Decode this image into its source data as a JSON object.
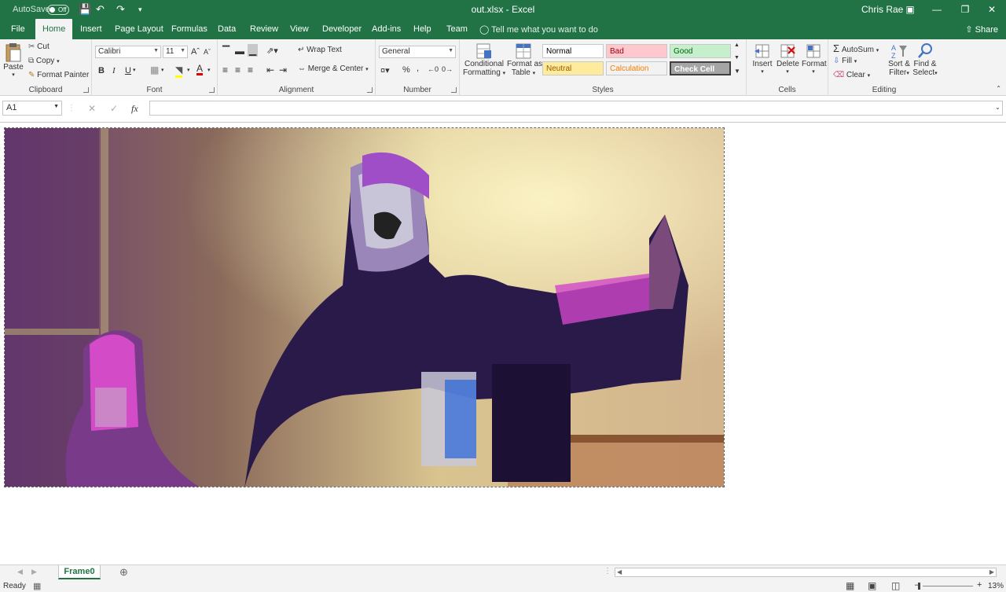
{
  "titlebar": {
    "autosave_label": "AutoSave",
    "autosave_state": "Off",
    "document_title": "out.xlsx  -  Excel",
    "user_name": "Chris Rae"
  },
  "tabs": [
    "File",
    "Home",
    "Insert",
    "Page Layout",
    "Formulas",
    "Data",
    "Review",
    "View",
    "Developer",
    "Add-ins",
    "Help",
    "Team"
  ],
  "active_tab": "Home",
  "tell_me_placeholder": "Tell me what you want to do",
  "share_label": "Share",
  "clipboard": {
    "paste": "Paste",
    "cut": "Cut",
    "copy": "Copy",
    "format_painter": "Format Painter",
    "group_label": "Clipboard"
  },
  "font": {
    "name": "Calibri",
    "size": "11",
    "bold": "B",
    "italic": "I",
    "underline": "U",
    "group_label": "Font"
  },
  "alignment": {
    "wrap_text": "Wrap Text",
    "merge_center": "Merge & Center",
    "group_label": "Alignment"
  },
  "number": {
    "format": "General",
    "percent": "%",
    "comma": ",",
    "group_label": "Number"
  },
  "styles": {
    "conditional_formatting": [
      "Conditional",
      "Formatting"
    ],
    "format_as_table": [
      "Format as",
      "Table"
    ],
    "cells": [
      {
        "label": "Normal",
        "bg": "#ffffff",
        "fg": "#000000"
      },
      {
        "label": "Bad",
        "bg": "#ffc7ce",
        "fg": "#9c0006"
      },
      {
        "label": "Good",
        "bg": "#c6efce",
        "fg": "#006100"
      },
      {
        "label": "Neutral",
        "bg": "#ffeb9c",
        "fg": "#9c5700"
      },
      {
        "label": "Calculation",
        "bg": "#f2f2f2",
        "fg": "#fa7d00"
      },
      {
        "label": "Check Cell",
        "bg": "#a5a5a5",
        "fg": "#ffffff"
      }
    ],
    "group_label": "Styles"
  },
  "cells_group": {
    "insert": "Insert",
    "delete": "Delete",
    "format": "Format",
    "group_label": "Cells"
  },
  "editing": {
    "autosum": "AutoSum",
    "fill": "Fill",
    "clear": "Clear",
    "sort_filter": [
      "Sort &",
      "Filter"
    ],
    "find_select": [
      "Find &",
      "Select"
    ],
    "group_label": "Editing"
  },
  "formula_bar": {
    "name_box": "A1",
    "fx": "fx",
    "value": ""
  },
  "sheet_tab": "Frame0",
  "status": {
    "ready": "Ready",
    "zoom": "13%"
  },
  "colors": {
    "accent": "#217346",
    "ribbon_bg": "#f3f3f3"
  }
}
